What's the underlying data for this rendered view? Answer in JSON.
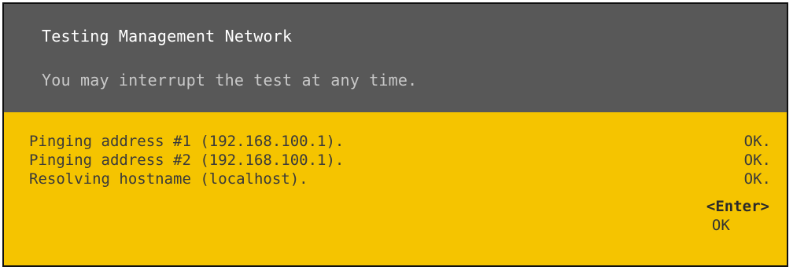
{
  "dialog": {
    "title": "Testing Management Network",
    "subtitle": "You may interrupt the test at any time."
  },
  "results": [
    {
      "label": "Pinging address #1 (192.168.100.1).",
      "status": "OK."
    },
    {
      "label": "Pinging address #2 (192.168.100.1).",
      "status": "OK."
    },
    {
      "label": "Resolving hostname (localhost).",
      "status": "OK."
    }
  ],
  "action": {
    "key": "<Enter>",
    "label": "OK"
  },
  "colors": {
    "header": "#585858",
    "body": "#f5c400",
    "title": "#ffffff",
    "subtitle": "#c8c8c8",
    "text": "#3a3a3a"
  }
}
